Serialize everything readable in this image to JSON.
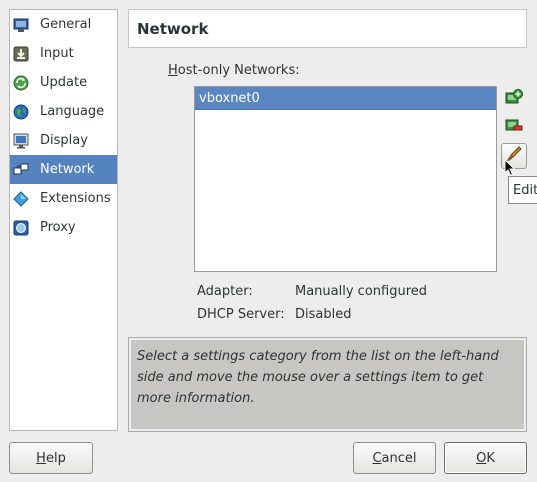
{
  "sidebar": {
    "items": [
      {
        "label": "General",
        "icon": "monitor-icon"
      },
      {
        "label": "Input",
        "icon": "input-download-icon"
      },
      {
        "label": "Update",
        "icon": "update-refresh-icon"
      },
      {
        "label": "Language",
        "icon": "globe-icon"
      },
      {
        "label": "Display",
        "icon": "display-monitor-icon"
      },
      {
        "label": "Network",
        "icon": "network-icon",
        "selected": true
      },
      {
        "label": "Extensions",
        "icon": "extensions-diamond-icon"
      },
      {
        "label": "Proxy",
        "icon": "proxy-globe-icon"
      }
    ]
  },
  "page": {
    "title": "Network"
  },
  "network": {
    "label_accel": "H",
    "label_rest": "ost-only Networks:",
    "networks": [
      "vboxnet0"
    ],
    "tooltip": "Edit",
    "adapter_label": "Adapter:",
    "adapter_value": "Manually configured",
    "dhcp_label": "DHCP Server:",
    "dhcp_value": "Disabled"
  },
  "description": {
    "text": "Select a settings category from the list on the left-hand side and move the mouse over a settings item to get more information."
  },
  "buttons": {
    "help_accel": "H",
    "help_rest": "elp",
    "cancel_accel": "C",
    "cancel_rest": "ancel",
    "ok_accel": "O",
    "ok_rest": "K"
  },
  "colors": {
    "selection": "#5583bf",
    "description_bg": "#c7c6c3",
    "window_bg": "#ededed"
  }
}
